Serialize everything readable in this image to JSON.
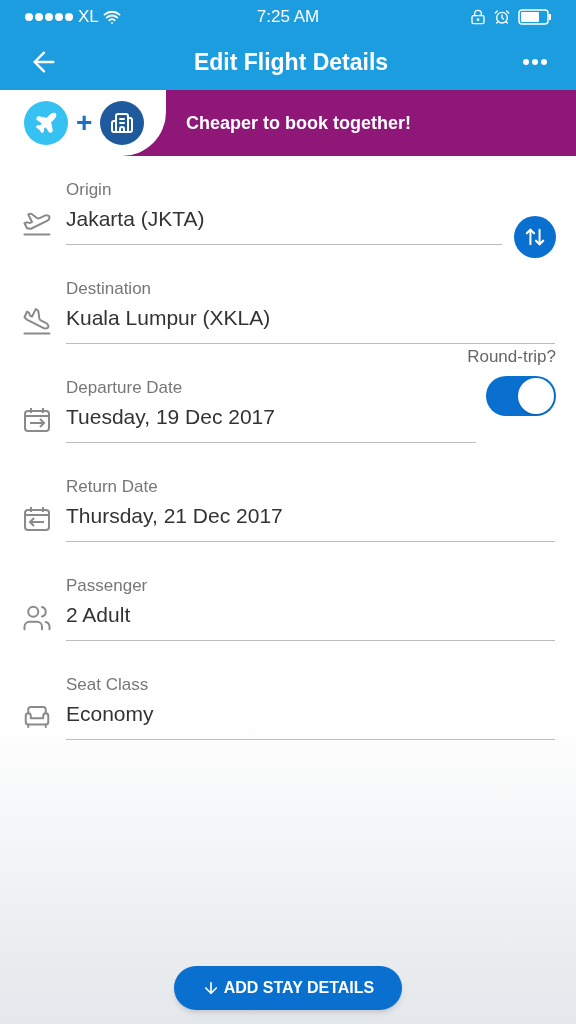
{
  "status_bar": {
    "carrier": "XL",
    "time": "7:25 AM"
  },
  "header": {
    "title": "Edit Flight Details"
  },
  "banner": {
    "join_symbol": "+",
    "text": "Cheaper to book together!"
  },
  "round_trip": {
    "label": "Round-trip?",
    "on": true
  },
  "fields": [
    {
      "kind": "origin",
      "label": "Origin",
      "value": "Jakarta (JKTA)"
    },
    {
      "kind": "destination",
      "label": "Destination",
      "value": "Kuala Lumpur (XKLA)"
    },
    {
      "kind": "departure",
      "label": "Departure Date",
      "value": "Tuesday, 19 Dec 2017"
    },
    {
      "kind": "return",
      "label": "Return Date",
      "value": "Thursday, 21 Dec 2017"
    },
    {
      "kind": "passenger",
      "label": "Passenger",
      "value": "2 Adult"
    },
    {
      "kind": "seat",
      "label": "Seat Class",
      "value": "Economy"
    }
  ],
  "action_button": {
    "label": "ADD STAY DETAILS"
  }
}
